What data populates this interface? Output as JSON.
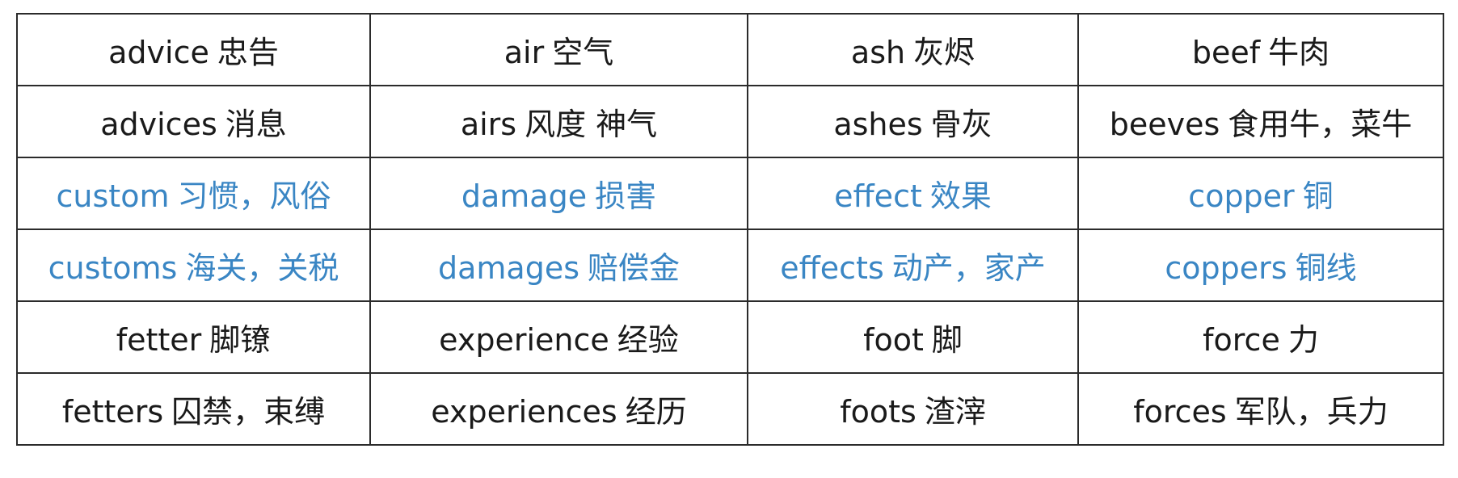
{
  "table": {
    "rows": [
      {
        "color": "black",
        "cells": [
          {
            "en": "advice",
            "zh": "忠告"
          },
          {
            "en": "air",
            "zh": "空气"
          },
          {
            "en": "ash",
            "zh": "灰烬"
          },
          {
            "en": "beef",
            "zh": "牛肉"
          }
        ]
      },
      {
        "color": "black",
        "cells": [
          {
            "en": "advices",
            "zh": "消息"
          },
          {
            "en": "airs",
            "zh": "风度 神气"
          },
          {
            "en": "ashes",
            "zh": "骨灰"
          },
          {
            "en": "beeves",
            "zh": "食用牛，菜牛"
          }
        ]
      },
      {
        "color": "blue",
        "cells": [
          {
            "en": "custom",
            "zh": "习惯，风俗"
          },
          {
            "en": "damage",
            "zh": "损害"
          },
          {
            "en": "effect",
            "zh": "效果"
          },
          {
            "en": "copper",
            "zh": "铜"
          }
        ]
      },
      {
        "color": "blue",
        "cells": [
          {
            "en": "customs",
            "zh": "海关，关税"
          },
          {
            "en": "damages",
            "zh": "赔偿金"
          },
          {
            "en": "effects",
            "zh": "动产，家产"
          },
          {
            "en": "coppers",
            "zh": "铜线"
          }
        ]
      },
      {
        "color": "black",
        "cells": [
          {
            "en": "fetter",
            "zh": "脚镣"
          },
          {
            "en": "experience",
            "zh": "经验"
          },
          {
            "en": "foot",
            "zh": "脚"
          },
          {
            "en": "force",
            "zh": "力"
          }
        ]
      },
      {
        "color": "black",
        "cells": [
          {
            "en": "fetters",
            "zh": "囚禁，束缚"
          },
          {
            "en": "experiences",
            "zh": "经历"
          },
          {
            "en": "foots",
            "zh": "渣滓"
          },
          {
            "en": "forces",
            "zh": "军队，兵力"
          }
        ]
      }
    ],
    "colors": {
      "black": "#1a1a1a",
      "blue": "#3a86c4",
      "border": "#2b2b2b"
    }
  }
}
